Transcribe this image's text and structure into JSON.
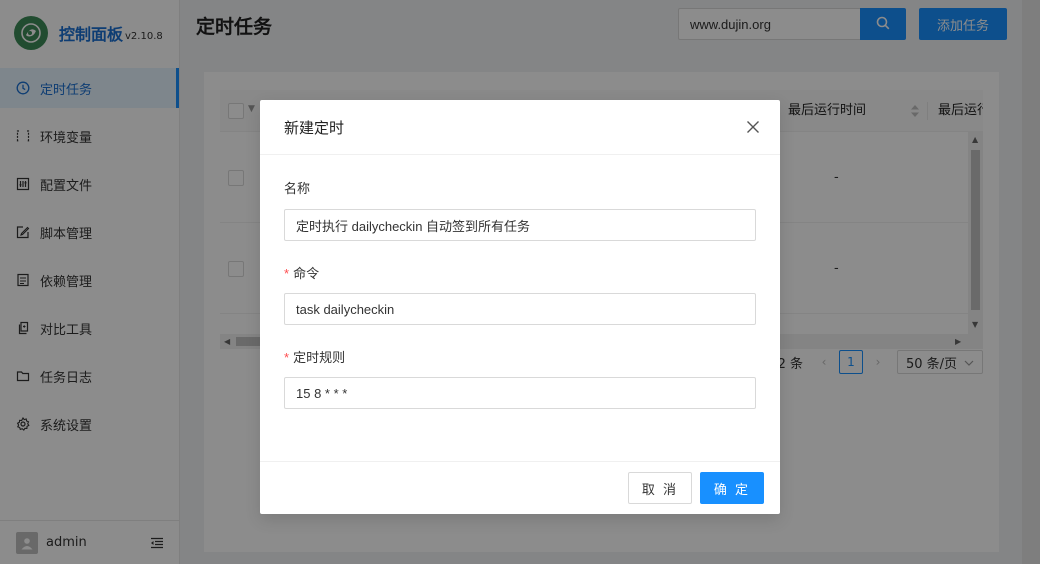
{
  "app": {
    "title": "控制面板",
    "version": "v2.10.8"
  },
  "sidebar": {
    "items": [
      {
        "label": "定时任务",
        "icon": "clock-icon",
        "active": true
      },
      {
        "label": "环境变量",
        "icon": "variable-icon",
        "active": false
      },
      {
        "label": "配置文件",
        "icon": "control-icon",
        "active": false
      },
      {
        "label": "脚本管理",
        "icon": "form-edit-icon",
        "active": false
      },
      {
        "label": "依赖管理",
        "icon": "container-icon",
        "active": false
      },
      {
        "label": "对比工具",
        "icon": "diff-icon",
        "active": false
      },
      {
        "label": "任务日志",
        "icon": "folder-icon",
        "active": false
      },
      {
        "label": "系统设置",
        "icon": "setting-icon",
        "active": false
      }
    ],
    "user": "admin"
  },
  "header": {
    "title": "定时任务",
    "search_value": "www.dujin.org",
    "add_button": "添加任务"
  },
  "table": {
    "columns": [
      "最后运行时间",
      "最后运行时"
    ],
    "rows": [
      {
        "last_run": "-"
      },
      {
        "last_run": "-"
      }
    ]
  },
  "pagination": {
    "total_text": "2 条",
    "current_page": "1",
    "page_size": "50 条/页"
  },
  "modal": {
    "title": "新建定时",
    "fields": {
      "name": {
        "label": "名称",
        "value": "定时执行 dailycheckin 自动签到所有任务",
        "required": false
      },
      "command": {
        "label": "命令",
        "value": "task dailycheckin",
        "required": true
      },
      "schedule": {
        "label": "定时规则",
        "value": "15 8 * * *",
        "required": true
      }
    },
    "cancel_label": "取 消",
    "ok_label": "确 定"
  },
  "colors": {
    "primary": "#1890ff",
    "active_bg": "#e6f4ff",
    "required": "#ff4d4f",
    "logo_green": "#3d8b58"
  }
}
